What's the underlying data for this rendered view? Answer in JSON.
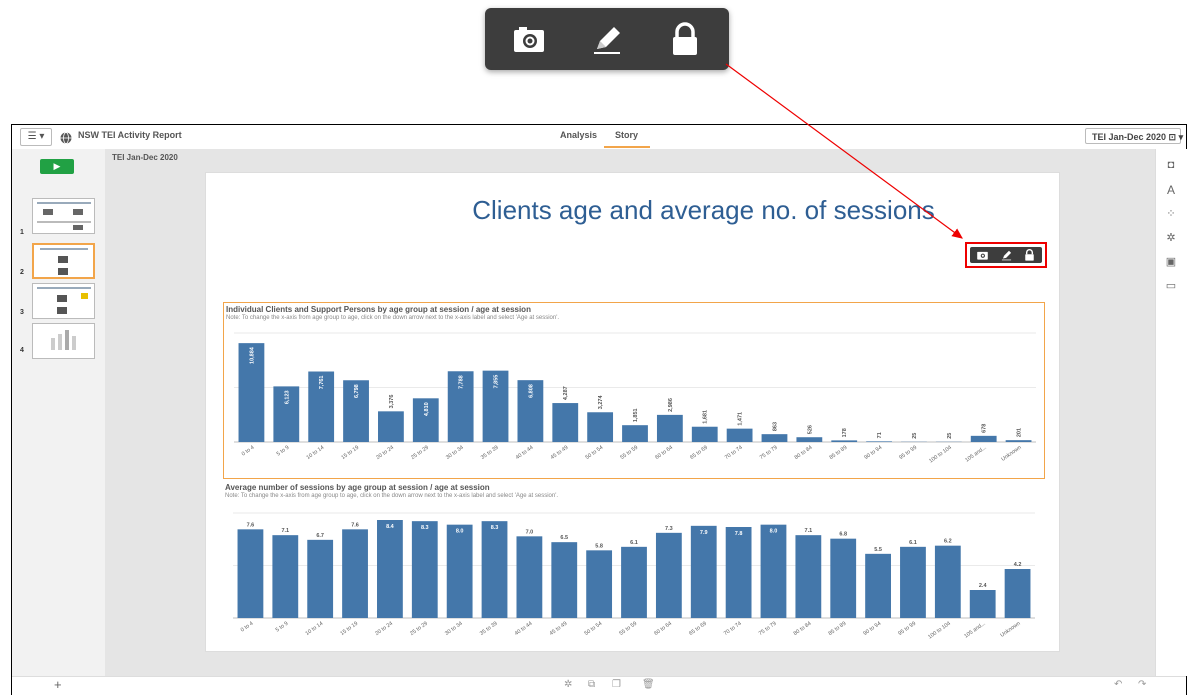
{
  "callout_toolbar": {
    "icons": [
      "camera-icon",
      "pencil-icon",
      "lock-icon"
    ]
  },
  "topbar": {
    "menu_label": "☰ ▾",
    "app_title": "NSW TEI Activity Report",
    "tabs": [
      {
        "label": "Analysis"
      },
      {
        "label": "Story"
      }
    ],
    "story_selector": "TEI Jan-Dec 2020 ⊡ ▾"
  },
  "left_panel": {
    "play_label": "▶",
    "slides": [
      {
        "num": "1"
      },
      {
        "num": "2"
      },
      {
        "num": "3"
      },
      {
        "num": "4"
      }
    ],
    "add_label": "+"
  },
  "canvas": {
    "story_label": "TEI Jan-Dec 2020",
    "slide_title": "Clients age and average no. of sessions"
  },
  "chart_data": [
    {
      "type": "bar",
      "title": "Individual Clients and Support Persons by age group at session / age at session",
      "note": "Note: To change the x-axis from age group to age, click on the down arrow next to the x-axis label and select 'Age at session'.",
      "categories": [
        "0 to 4",
        "5 to 9",
        "10 to 14",
        "15 to 19",
        "20 to 24",
        "25 to 29",
        "30 to 34",
        "35 to 39",
        "40 to 44",
        "45 to 49",
        "50 to 54",
        "55 to 59",
        "60 to 64",
        "65 to 69",
        "70 to 74",
        "75 to 79",
        "80 to 84",
        "85 to 89",
        "90 to 94",
        "95 to 99",
        "100 to 104",
        "105 and...",
        "Unknown"
      ],
      "values": [
        10884,
        6123,
        7761,
        6798,
        3376,
        4810,
        7788,
        7855,
        6808,
        4287,
        3274,
        1851,
        2986,
        1681,
        1471,
        863,
        526,
        178,
        71,
        25,
        25,
        678,
        201
      ],
      "labels": [
        "10,884",
        "6,123",
        "7,761",
        "6,798",
        "3,376",
        "4,810",
        "7,788",
        "7,855",
        "6,808",
        "4,287",
        "3,274",
        "1,851",
        "2,986",
        "1,681",
        "1,471",
        "863",
        "526",
        "178",
        "71",
        "25",
        "25",
        "678",
        "201"
      ],
      "ylim": [
        0,
        12000
      ],
      "color": "#4477aa"
    },
    {
      "type": "bar",
      "title": "Average number of sessions by age group at session / age at session",
      "note": "Note: To change the x-axis from age group to age, click on the down arrow next to the x-axis label and select 'Age at session'.",
      "categories": [
        "0 to 4",
        "5 to 9",
        "10 to 14",
        "15 to 19",
        "20 to 24",
        "25 to 29",
        "30 to 34",
        "35 to 39",
        "40 to 44",
        "45 to 49",
        "50 to 54",
        "55 to 59",
        "60 to 64",
        "65 to 69",
        "70 to 74",
        "75 to 79",
        "80 to 84",
        "85 to 89",
        "90 to 94",
        "95 to 99",
        "100 to 104",
        "105 and...",
        "Unknown"
      ],
      "values": [
        7.6,
        7.1,
        6.7,
        7.6,
        8.4,
        8.3,
        8.0,
        8.3,
        7.0,
        6.5,
        5.8,
        6.1,
        7.3,
        7.9,
        7.8,
        8.0,
        7.1,
        6.8,
        5.5,
        6.1,
        6.2,
        2.4,
        4.2
      ],
      "labels": [
        "7.6",
        "7.1",
        "6.7",
        "7.6",
        "8.4",
        "8.3",
        "8.0",
        "8.3",
        "7.0",
        "6.5",
        "5.8",
        "6.1",
        "7.3",
        "7.9",
        "7.8",
        "8.0",
        "7.1",
        "6.8",
        "5.5",
        "6.1",
        "6.2",
        "2.4",
        "4.2"
      ],
      "ylim": [
        0,
        9
      ],
      "color": "#4477aa"
    }
  ]
}
